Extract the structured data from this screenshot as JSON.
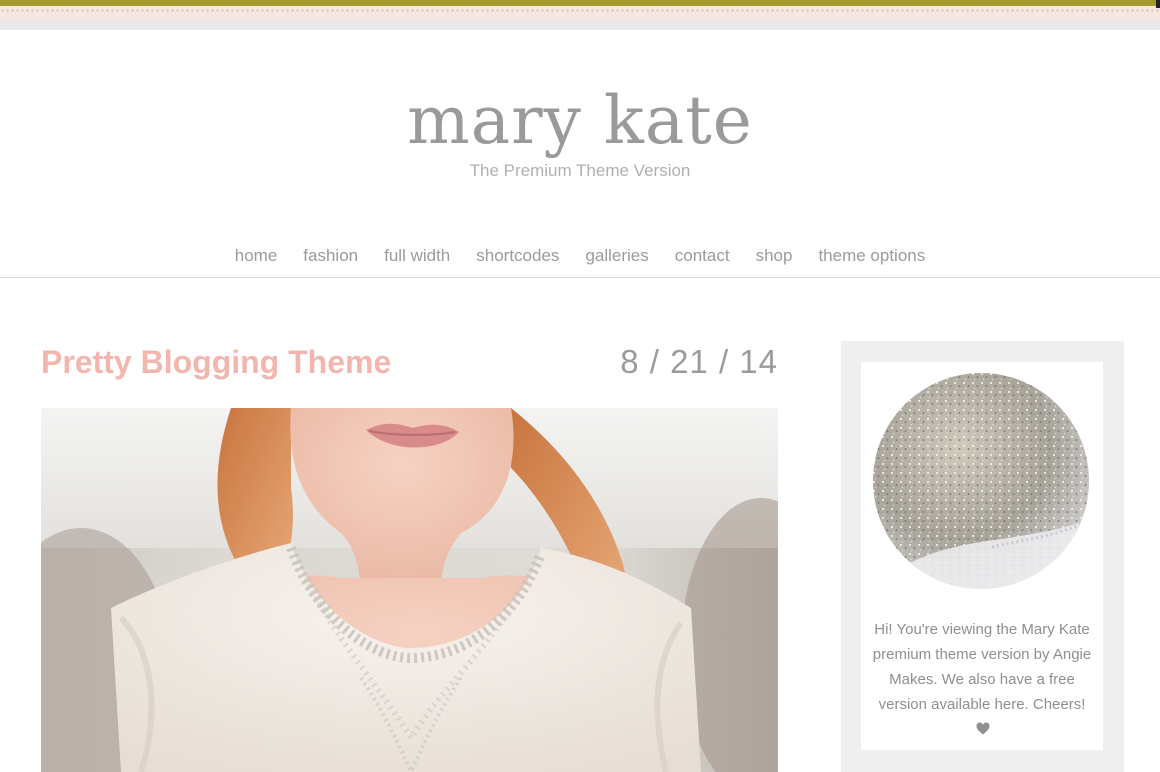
{
  "header": {
    "site_title": "mary kate",
    "tagline": "The Premium Theme Version"
  },
  "nav": {
    "items": [
      {
        "label": "home"
      },
      {
        "label": "fashion"
      },
      {
        "label": "full width"
      },
      {
        "label": "shortcodes"
      },
      {
        "label": "galleries"
      },
      {
        "label": "contact"
      },
      {
        "label": "shop"
      },
      {
        "label": "theme options"
      }
    ]
  },
  "post": {
    "title": "Pretty Blogging Theme",
    "date": "8 / 21 / 14",
    "image_icon": "photo-of-girl-in-beaded-white-top"
  },
  "sidebar": {
    "photo_icon": "silver-glitter-circle",
    "about_text": "Hi! You're viewing the Mary Kate premium theme version by Angie Makes. We also have a free version available here. Cheers!",
    "heart_icon": "heart-icon"
  },
  "colors": {
    "accent_pink": "#f2b6ae",
    "text_grey": "#9b9b9b",
    "border_gold": "#a39a2c",
    "sidebar_bg": "#efefef"
  }
}
